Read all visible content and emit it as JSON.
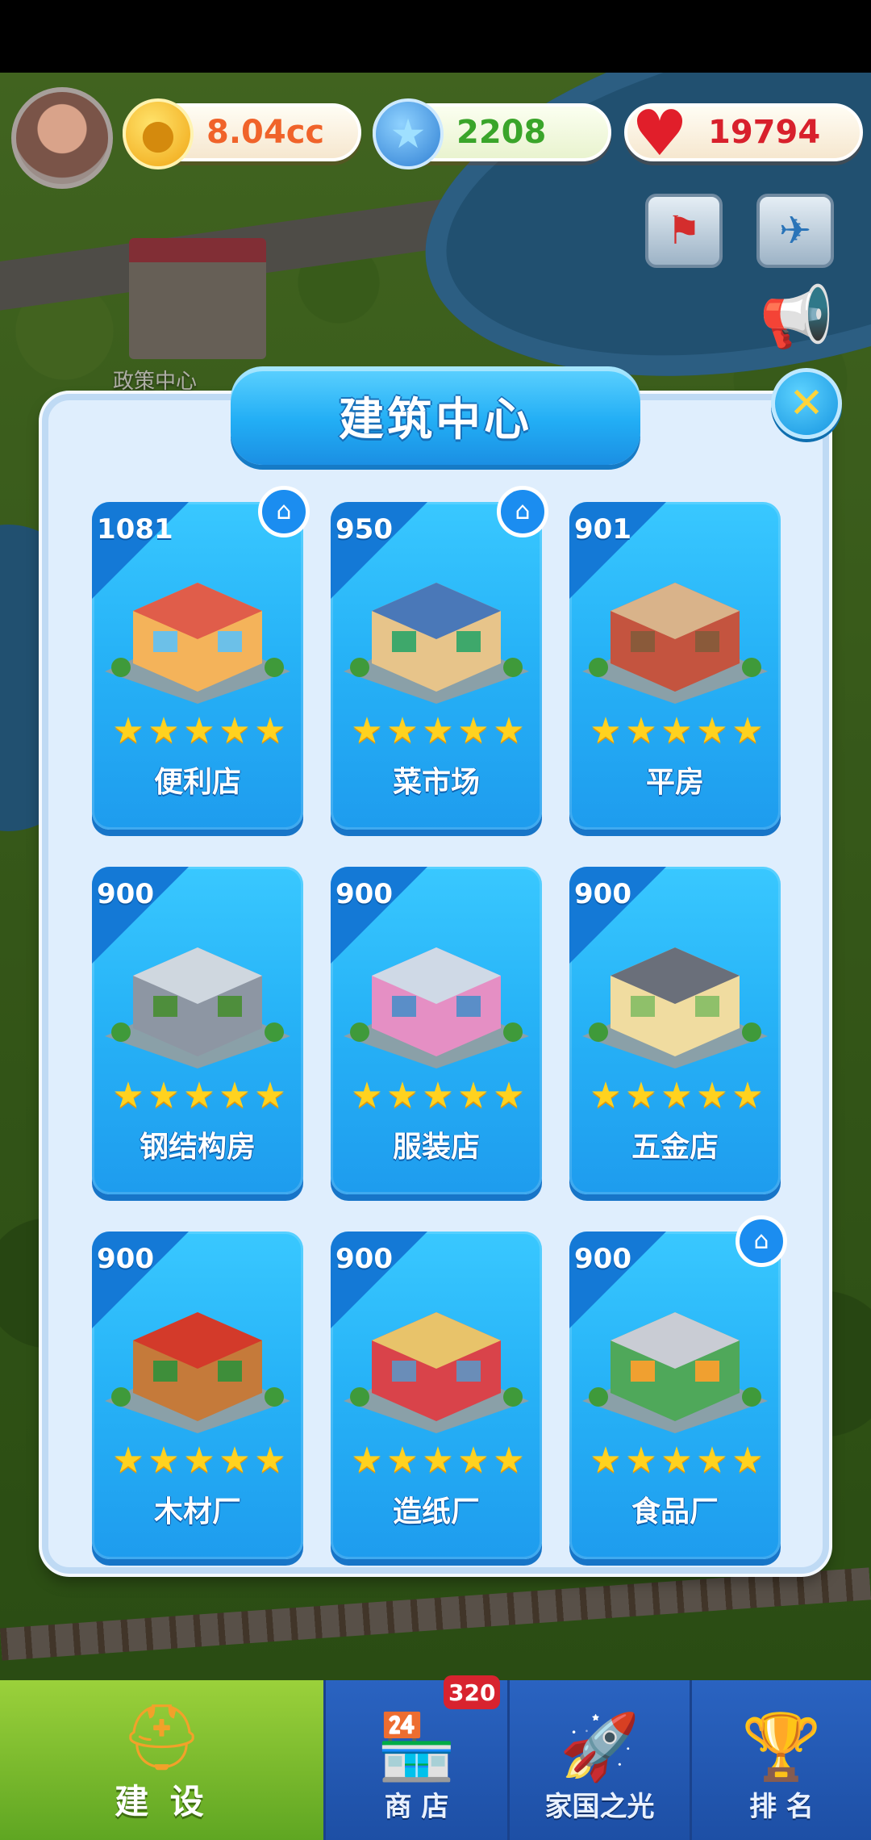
{
  "hud": {
    "coins": "8.04cc",
    "stars": "2208",
    "hearts": "19794",
    "coin_icon": "coin-icon",
    "star_icon": "star-icon",
    "heart_icon": "heart-icon"
  },
  "background": {
    "building_label": "政策中心"
  },
  "panel": {
    "title": "建筑中心",
    "close_icon": "close-icon"
  },
  "buildings": [
    {
      "name": "便利店",
      "count": "1081",
      "stars": 5,
      "has_home_badge": true
    },
    {
      "name": "菜市场",
      "count": "950",
      "stars": 5,
      "has_home_badge": true
    },
    {
      "name": "平房",
      "count": "901",
      "stars": 5,
      "has_home_badge": false
    },
    {
      "name": "钢结构房",
      "count": "900",
      "stars": 5,
      "has_home_badge": false
    },
    {
      "name": "服装店",
      "count": "900",
      "stars": 5,
      "has_home_badge": false
    },
    {
      "name": "五金店",
      "count": "900",
      "stars": 5,
      "has_home_badge": false
    },
    {
      "name": "木材厂",
      "count": "900",
      "stars": 5,
      "has_home_badge": false
    },
    {
      "name": "造纸厂",
      "count": "900",
      "stars": 5,
      "has_home_badge": false
    },
    {
      "name": "食品厂",
      "count": "900",
      "stars": 5,
      "has_home_badge": true
    }
  ],
  "nav": {
    "items": [
      {
        "label": "建 设",
        "icon": "hardhat-icon",
        "active": true
      },
      {
        "label": "商 店",
        "icon": "shop-icon",
        "badge": "320"
      },
      {
        "label": "家国之光",
        "icon": "rocket-icon"
      },
      {
        "label": "排 名",
        "icon": "ranking-icon"
      }
    ]
  },
  "colors": {
    "panel_bg": "#dfeefd",
    "card_blue": "#27b3f7",
    "star_yellow": "#ffd21f",
    "nav_blue": "#2a63c1",
    "nav_active": "#7fbf2d"
  }
}
